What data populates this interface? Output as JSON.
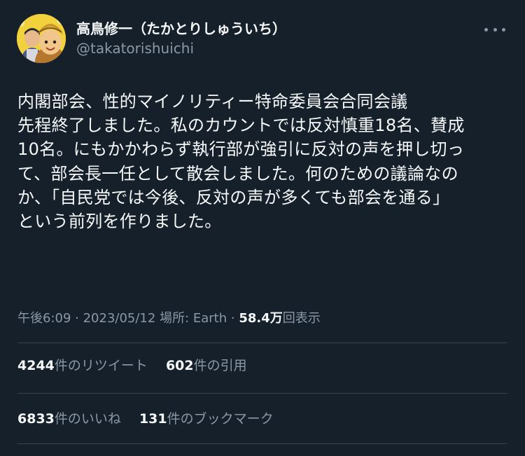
{
  "author": {
    "display_name": "高鳥修一（たかとりしゅういち）",
    "handle": "@takatorishuichi",
    "avatar_icon": "cartoon-mascot-avatar"
  },
  "more_icon": "more-options-icon",
  "tweet_text": "内閣部会、性的マイノリティー特命委員会合同会議\n先程終了しました。私のカウントでは反対慎重18名、賛成\n10名。にもかかわらず執行部が強引に反対の声を押し切っ\nて、部会長一任として散会しました。何のための議論なの\nか、「自民党では今後、反対の声が多くても部会を通る」\nという前列を作りました。",
  "meta": {
    "time": "午後6:09",
    "sep1": " · ",
    "date": "2023/05/12",
    "sep2": " ",
    "location": "場所: Earth",
    "sep3": " · ",
    "views_count": "58.4万",
    "views_label": "回表示"
  },
  "stats": {
    "retweets_count": "4244",
    "retweets_label": "件のリツイート",
    "quotes_count": "602",
    "quotes_label": "件の引用",
    "likes_count": "6833",
    "likes_label": "件のいいね",
    "bookmarks_count": "131",
    "bookmarks_label": "件のブックマーク"
  },
  "colors": {
    "background": "#15202b",
    "primary_text": "#f7f9f9",
    "secondary_text": "#8b98a5",
    "divider": "#38444d"
  }
}
